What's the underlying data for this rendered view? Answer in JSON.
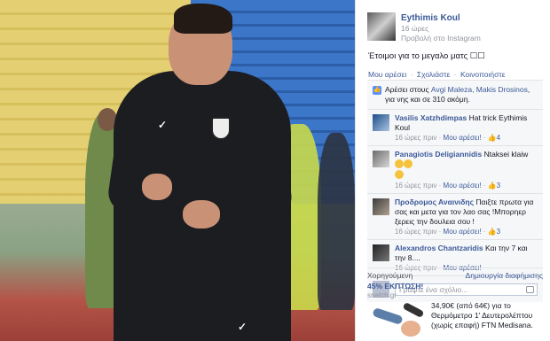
{
  "post": {
    "author": "Eythimis Koul",
    "time": "16 ώρες",
    "source": "Προβολή στο Instagram",
    "text": "Έτοιμοι για το μεγαλο ματς ☐☐"
  },
  "actions": {
    "like": "Μου αρέσει",
    "comment": "Σχολιάστε",
    "share": "Κοινοποιήστε",
    "separator": "·"
  },
  "likes": {
    "prefix": "Αρέσει στους",
    "names": "Avgi Maleza, Makis Drosinos",
    "suffix": ", για νης και σε 310 ακόμη."
  },
  "comments": [
    {
      "name": "Vasilis Xatzhdimpas",
      "text": "Hat trick Eythimis Koul",
      "time": "16 ώρες πριν",
      "like": "Μου αρέσει!",
      "count": "4"
    },
    {
      "name": "Panagiotis Deligiannidis",
      "text": "Ntaksei klaiw",
      "time": "16 ώρες πριν",
      "like": "Μου αρέσει!",
      "count": "3"
    },
    {
      "name": "Προδρομος Αναινιδης",
      "text": "Παιξτε πρωτα για σας και μετα για τον λαο σας !Μπορηερ ξερεις την δουλεια σου !",
      "time": "16 ώρες πριν",
      "like": "Μου αρέσει!",
      "count": "3"
    },
    {
      "name": "Alexandros Chantzaridis",
      "text": "Και την 7 και την 8....",
      "time": "16 ώρες πριν",
      "like": "Μου αρέσει!",
      "count": ""
    }
  ],
  "write_comment": {
    "placeholder": "Γράψτε ένα σχόλιο..."
  },
  "ads": {
    "sponsored": "Χορηγούμενη",
    "create": "Δημιουργία διαφήμισης",
    "title": "45% ΕΚΠΤΩΣΗ!",
    "domain": "snatch.gr",
    "copy": "34,90€ (από 64€) για το Θερμόμετρο 1' Δευτερολέπτου (χωρίς επαφή) FTN Medisana."
  },
  "colors": {
    "link": "#3b5998",
    "meta": "#90949c",
    "ufi_bg": "#f6f7f9",
    "like_badge": "#5890ff"
  }
}
